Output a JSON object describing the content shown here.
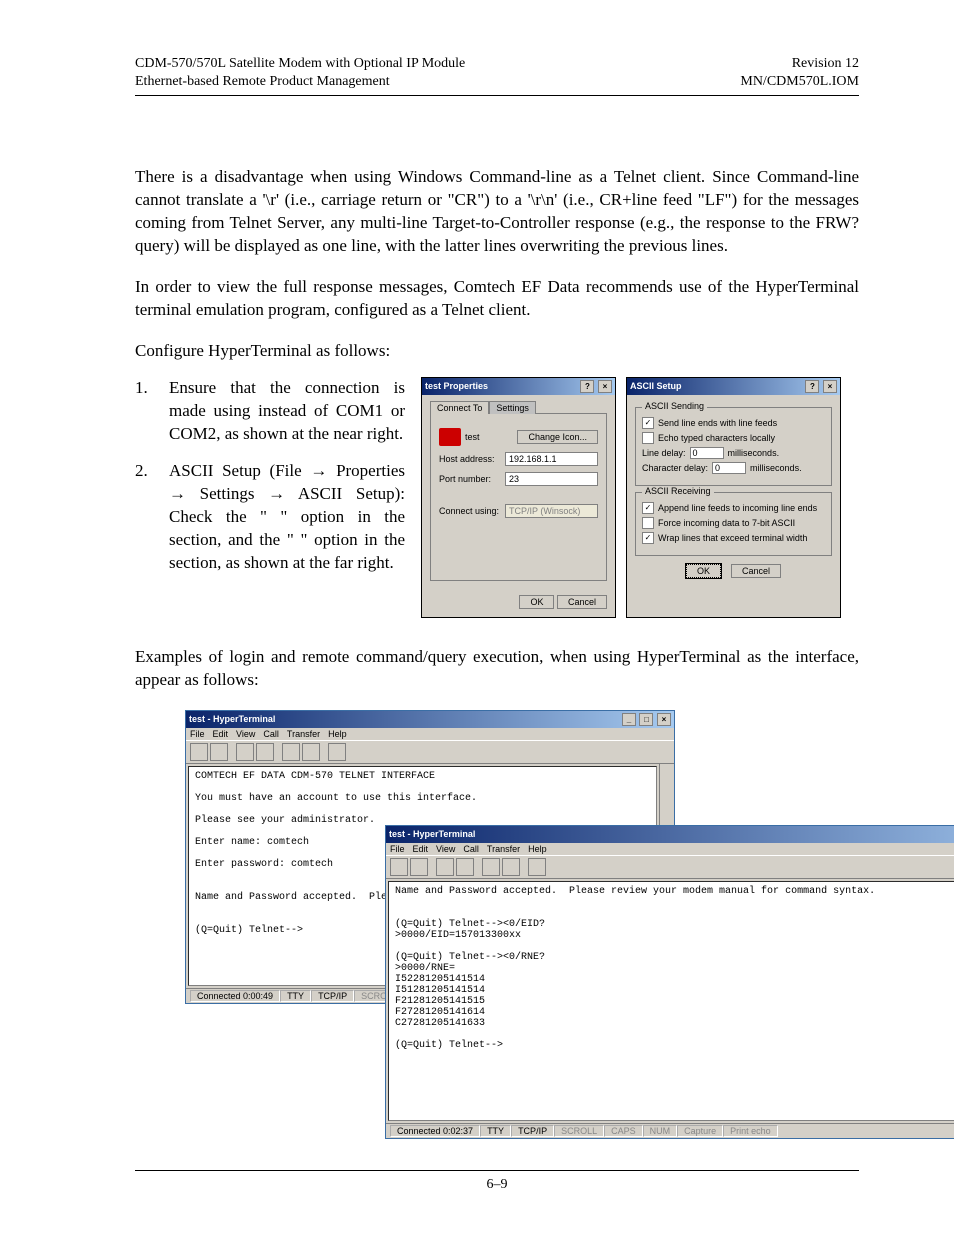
{
  "header": {
    "left1": "CDM-570/570L Satellite Modem with Optional IP Module",
    "left2": "Ethernet-based Remote Product Management",
    "right1": "Revision 12",
    "right2": "MN/CDM570L.IOM"
  },
  "para1": "There is a disadvantage when using Windows Command-line as a Telnet client. Since Command-line cannot translate a '\\r' (i.e., carriage return or \"CR\") to a '\\r\\n' (i.e., CR+line feed \"LF\") for the messages coming from Telnet Server, any multi-line Target-to-Controller response (e.g., the response to the FRW? query) will be displayed as one line, with the latter lines overwriting the previous lines.",
  "para2": "In order to view the full response messages, Comtech EF Data recommends use of the HyperTerminal terminal emulation program, configured as a Telnet client.",
  "para3": "Configure HyperTerminal as follows:",
  "list1": "Ensure that the connection is made using                                     instead of COM1 or COM2, as shown at the near right.",
  "list2": "ASCII Setup (File → Properties → Settings → ASCII Setup): Check the  \"                                         \"  option  in the                                       section,  and  the  \"                                                                     \" option   in   the                                      section, as shown at the far right.",
  "para4": "Examples of login and remote command/query execution, when using HyperTerminal as the interface, appear as follows:",
  "dlg_props": {
    "title": "test Properties",
    "tab_connect": "Connect To",
    "tab_settings": "Settings",
    "icon_label": "test",
    "change_icon": "Change Icon...",
    "host_label": "Host address:",
    "host_value": "192.168.1.1",
    "port_label": "Port number:",
    "port_value": "23",
    "connect_label": "Connect using:",
    "connect_value": "TCP/IP (Winsock)",
    "ok": "OK",
    "cancel": "Cancel"
  },
  "dlg_ascii": {
    "title": "ASCII Setup",
    "grp_send": "ASCII Sending",
    "send_line_ends": "Send line ends with line feeds",
    "echo": "Echo typed characters locally",
    "line_delay_label": "Line delay:",
    "line_delay_value": "0",
    "line_delay_unit": "milliseconds.",
    "char_delay_label": "Character delay:",
    "char_delay_value": "0",
    "char_delay_unit": "milliseconds.",
    "grp_recv": "ASCII Receiving",
    "append": "Append line feeds to incoming line ends",
    "force7": "Force incoming data to 7-bit ASCII",
    "wrap": "Wrap lines that exceed terminal width",
    "ok": "OK",
    "cancel": "Cancel"
  },
  "ht1": {
    "title": "test - HyperTerminal",
    "menu": {
      "file": "File",
      "edit": "Edit",
      "view": "View",
      "call": "Call",
      "transfer": "Transfer",
      "help": "Help"
    },
    "term": "COMTECH EF DATA CDM-570 TELNET INTERFACE\n\nYou must have an account to use this interface.\n\nPlease see your administrator.\n\nEnter name: comtech\n\nEnter password: comtech\n\n\nName and Password accepted.  Plea\n\n\n(Q=Quit) Telnet-->",
    "status": {
      "connected": "Connected 0:00:49",
      "tty": "TTY",
      "proto": "TCP/IP",
      "scroll": "SCROLL"
    }
  },
  "ht2": {
    "title": "test - HyperTerminal",
    "menu": {
      "file": "File",
      "edit": "Edit",
      "view": "View",
      "call": "Call",
      "transfer": "Transfer",
      "help": "Help"
    },
    "term": "Name and Password accepted.  Please review your modem manual for command syntax.\n\n\n(Q=Quit) Telnet--><0/EID?\n>0000/EID=157013300xx\n\n(Q=Quit) Telnet--><0/RNE?\n>0000/RNE=\nI52281205141514\nI51281205141514\nF21281205141515\nF27281205141614\nC27281205141633\n\n(Q=Quit) Telnet-->",
    "status": {
      "connected": "Connected 0:02:37",
      "tty": "TTY",
      "proto": "TCP/IP",
      "scroll": "SCROLL",
      "caps": "CAPS",
      "num": "NUM",
      "capture": "Capture",
      "echo": "Print echo"
    }
  },
  "footer": "6–9"
}
